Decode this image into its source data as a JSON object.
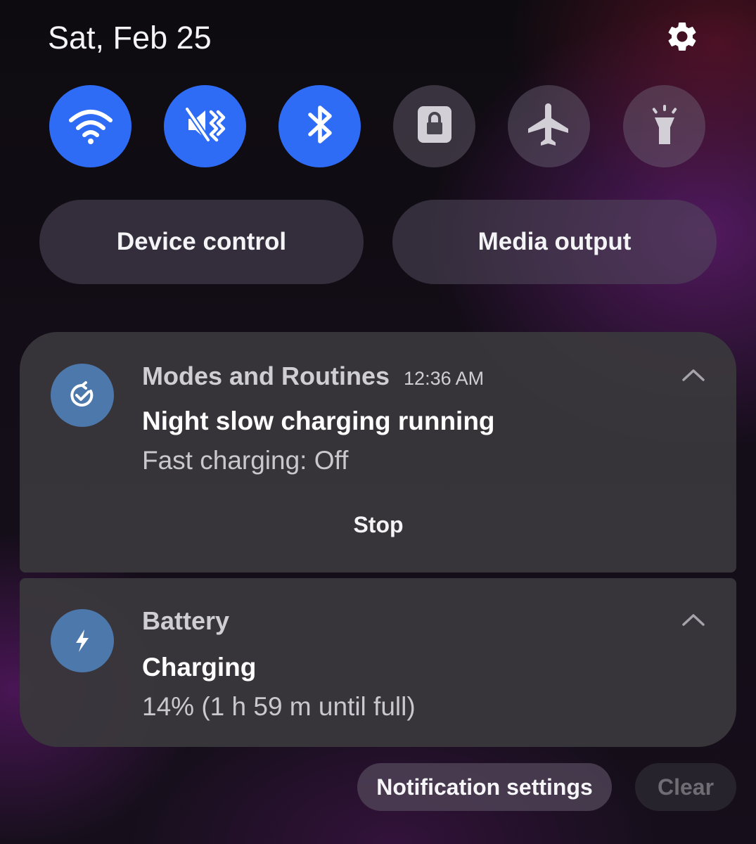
{
  "header": {
    "date": "Sat, Feb 25",
    "settings_icon": "gear-icon"
  },
  "quick_toggles": [
    {
      "icon": "wifi-icon",
      "state": "on"
    },
    {
      "icon": "vibrate-mute-icon",
      "state": "on"
    },
    {
      "icon": "bluetooth-icon",
      "state": "on"
    },
    {
      "icon": "lock-rotation-icon",
      "state": "off"
    },
    {
      "icon": "airplane-icon",
      "state": "off"
    },
    {
      "icon": "flashlight-icon",
      "state": "off"
    }
  ],
  "pills": {
    "device_control": "Device control",
    "media_output": "Media output"
  },
  "notifications": [
    {
      "app": "Modes and Routines",
      "time": "12:36 AM",
      "title": "Night slow charging running",
      "body": "Fast charging: Off",
      "action": "Stop",
      "icon": "routine-check-icon"
    },
    {
      "app": "Battery",
      "title": "Charging",
      "body": "14% (1 h 59 m until full)",
      "icon": "lightning-bolt-icon"
    }
  ],
  "footer": {
    "notification_settings": "Notification settings",
    "clear": "Clear"
  },
  "colors": {
    "toggle_on": "#2f6cf6",
    "app_icon_bg": "#4d78ab"
  }
}
